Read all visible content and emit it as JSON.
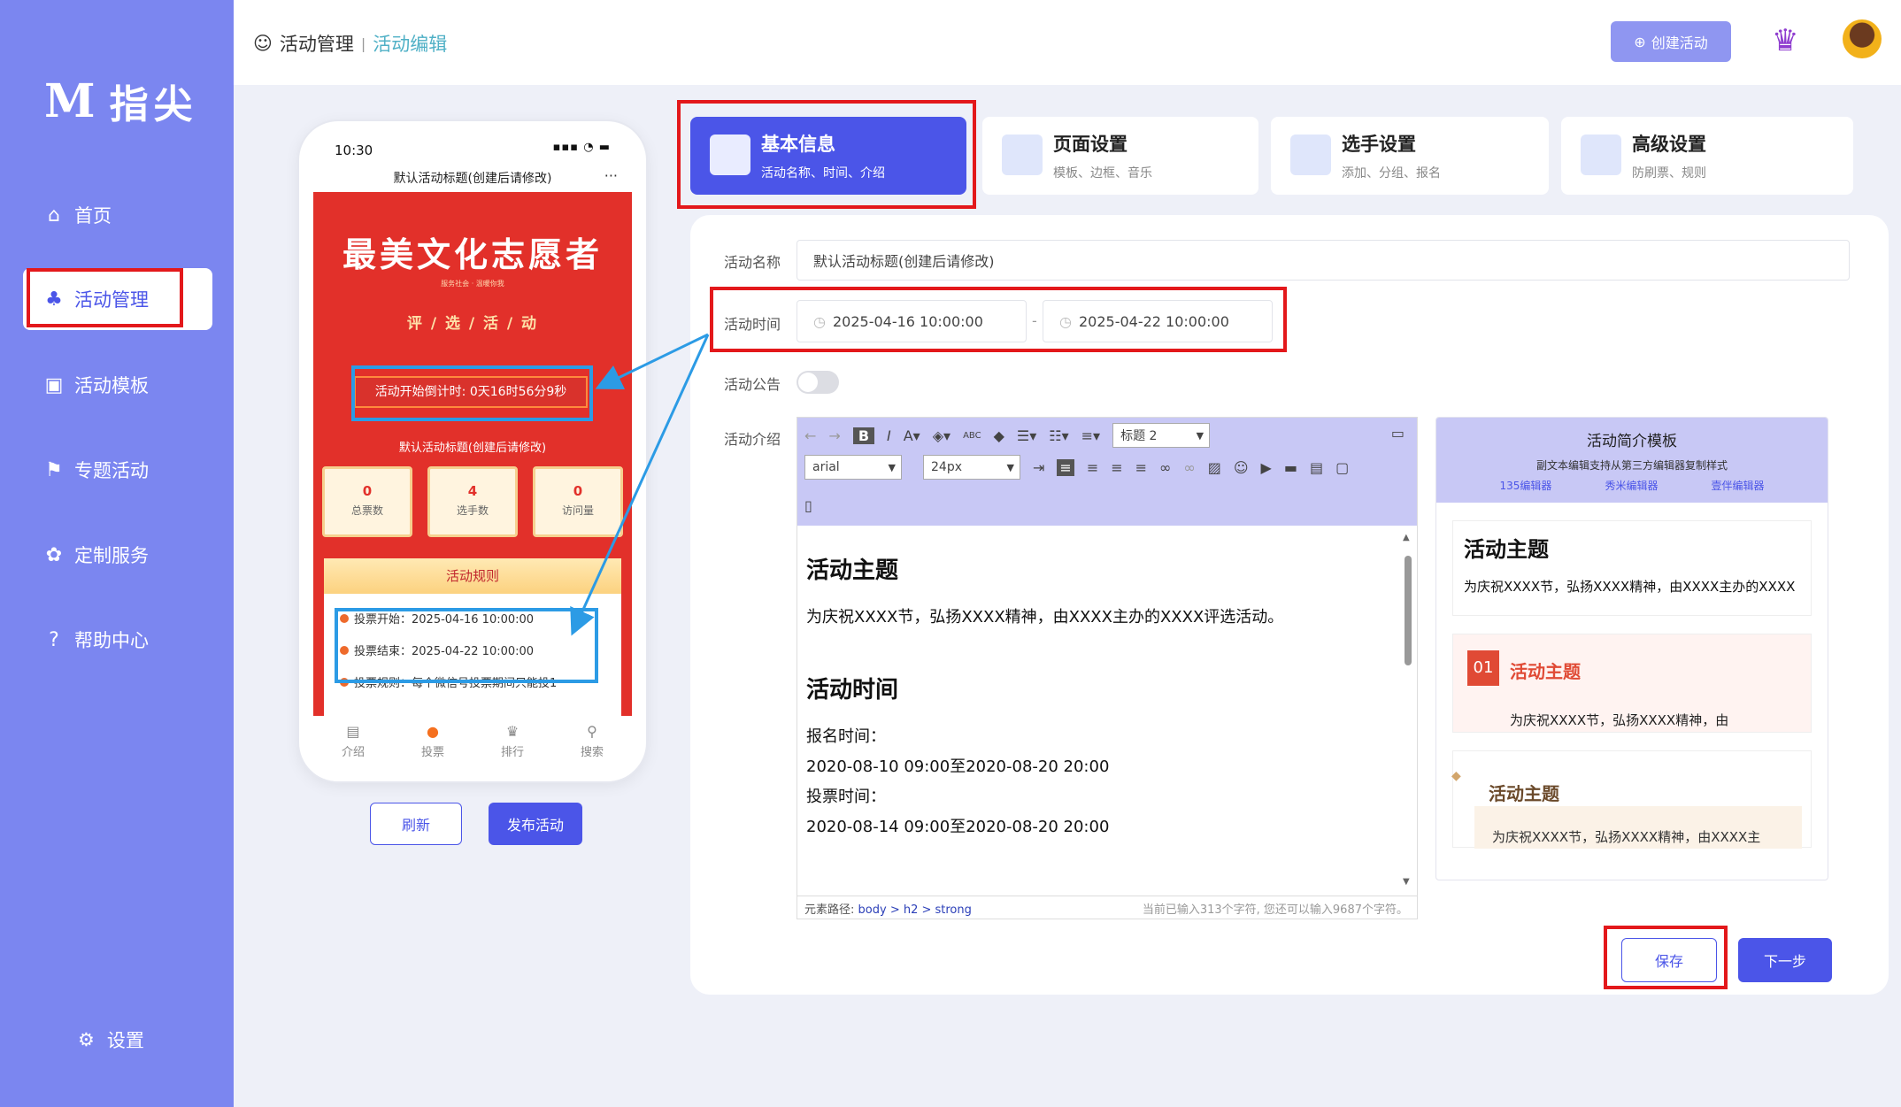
{
  "brand": {
    "logo_mark": "M",
    "name": "指尖"
  },
  "nav": {
    "items": [
      {
        "label": "首页",
        "icon": "home-icon"
      },
      {
        "label": "活动管理",
        "icon": "activity-icon"
      },
      {
        "label": "活动模板",
        "icon": "image-icon"
      },
      {
        "label": "专题活动",
        "icon": "flag-icon"
      },
      {
        "label": "定制服务",
        "icon": "custom-icon"
      },
      {
        "label": "帮助中心",
        "icon": "help-icon"
      }
    ],
    "active": "活动管理",
    "settings": "设置"
  },
  "header": {
    "breadcrumb": [
      "活动管理",
      "活动编辑"
    ],
    "create_label": "创建活动"
  },
  "phone": {
    "time": "10:30",
    "title": "默认活动标题(创建后请修改)",
    "banner_title": "最美文化志愿者",
    "banner_sub": "服务社会 · 温暖你我",
    "pill": "评 / 选 / 活 / 动",
    "countdown": "活动开始倒计时: 0天16时56分9秒",
    "vote_title": "默认活动标题(创建后请修改)",
    "stats": [
      {
        "n": "0",
        "l": "总票数"
      },
      {
        "n": "4",
        "l": "选手数"
      },
      {
        "n": "0",
        "l": "访问量"
      }
    ],
    "rules_title": "活动规则",
    "rules": [
      "投票开始：2025-04-16 10:00:00",
      "投票结束：2025-04-22 10:00:00",
      "投票规则：每个微信号投票期间只能投1"
    ],
    "tabs": [
      "介绍",
      "投票",
      "排行",
      "搜索"
    ]
  },
  "actions": {
    "refresh": "刷新",
    "publish": "发布活动",
    "save": "保存",
    "next": "下一步"
  },
  "steps": [
    {
      "title": "基本信息",
      "desc": "活动名称、时间、介绍"
    },
    {
      "title": "页面设置",
      "desc": "模板、边框、音乐"
    },
    {
      "title": "选手设置",
      "desc": "添加、分组、报名"
    },
    {
      "title": "高级设置",
      "desc": "防刷票、规则"
    }
  ],
  "form": {
    "name_label": "活动名称",
    "name_value": "默认活动标题(创建后请修改)",
    "time_label": "活动时间",
    "start": "2025-04-16 10:00:00",
    "end": "2025-04-22 10:00:00",
    "time_sep": "-",
    "notice_label": "活动公告",
    "intro_label": "活动介绍"
  },
  "editor": {
    "font": "arial",
    "size": "24px",
    "heading": "标题 2",
    "abc": "ABC",
    "content": {
      "h1": "活动主题",
      "p1": "为庆祝XXXX节，弘扬XXXX精神，由XXXX主办的XXXX评选活动。",
      "h2": "活动时间",
      "p2": "报名时间：",
      "p3": "2020-08-10 09:00至2020-08-20 20:00",
      "p4": "投票时间：",
      "p5": "2020-08-14 09:00至2020-08-20 20:00"
    },
    "path_label": "元素路径:",
    "path": "body > h2 > strong",
    "count": "当前已输入313个字符, 您还可以输入9687个字符。"
  },
  "templates": {
    "title": "活动简介模板",
    "subtitle": "副文本编辑支持从第三方编辑器复制样式",
    "links": [
      "135编辑器",
      "秀米编辑器",
      "壹伴编辑器"
    ],
    "card1": {
      "title": "活动主题",
      "text": "为庆祝XXXX节，弘扬XXXX精神，由XXXX主办的XXXX"
    },
    "card2": {
      "num": "01",
      "title": "活动主题",
      "text": "为庆祝XXXX节，弘扬XXXX精神，由"
    },
    "card3": {
      "title": "活动主题",
      "text": "为庆祝XXXX节，弘扬XXXX精神，由XXXX主"
    }
  },
  "colors": {
    "primary": "#4b55e8",
    "sidebar": "#7b86f0",
    "highlight": "#e3181b",
    "arrow": "#2c9be5"
  }
}
